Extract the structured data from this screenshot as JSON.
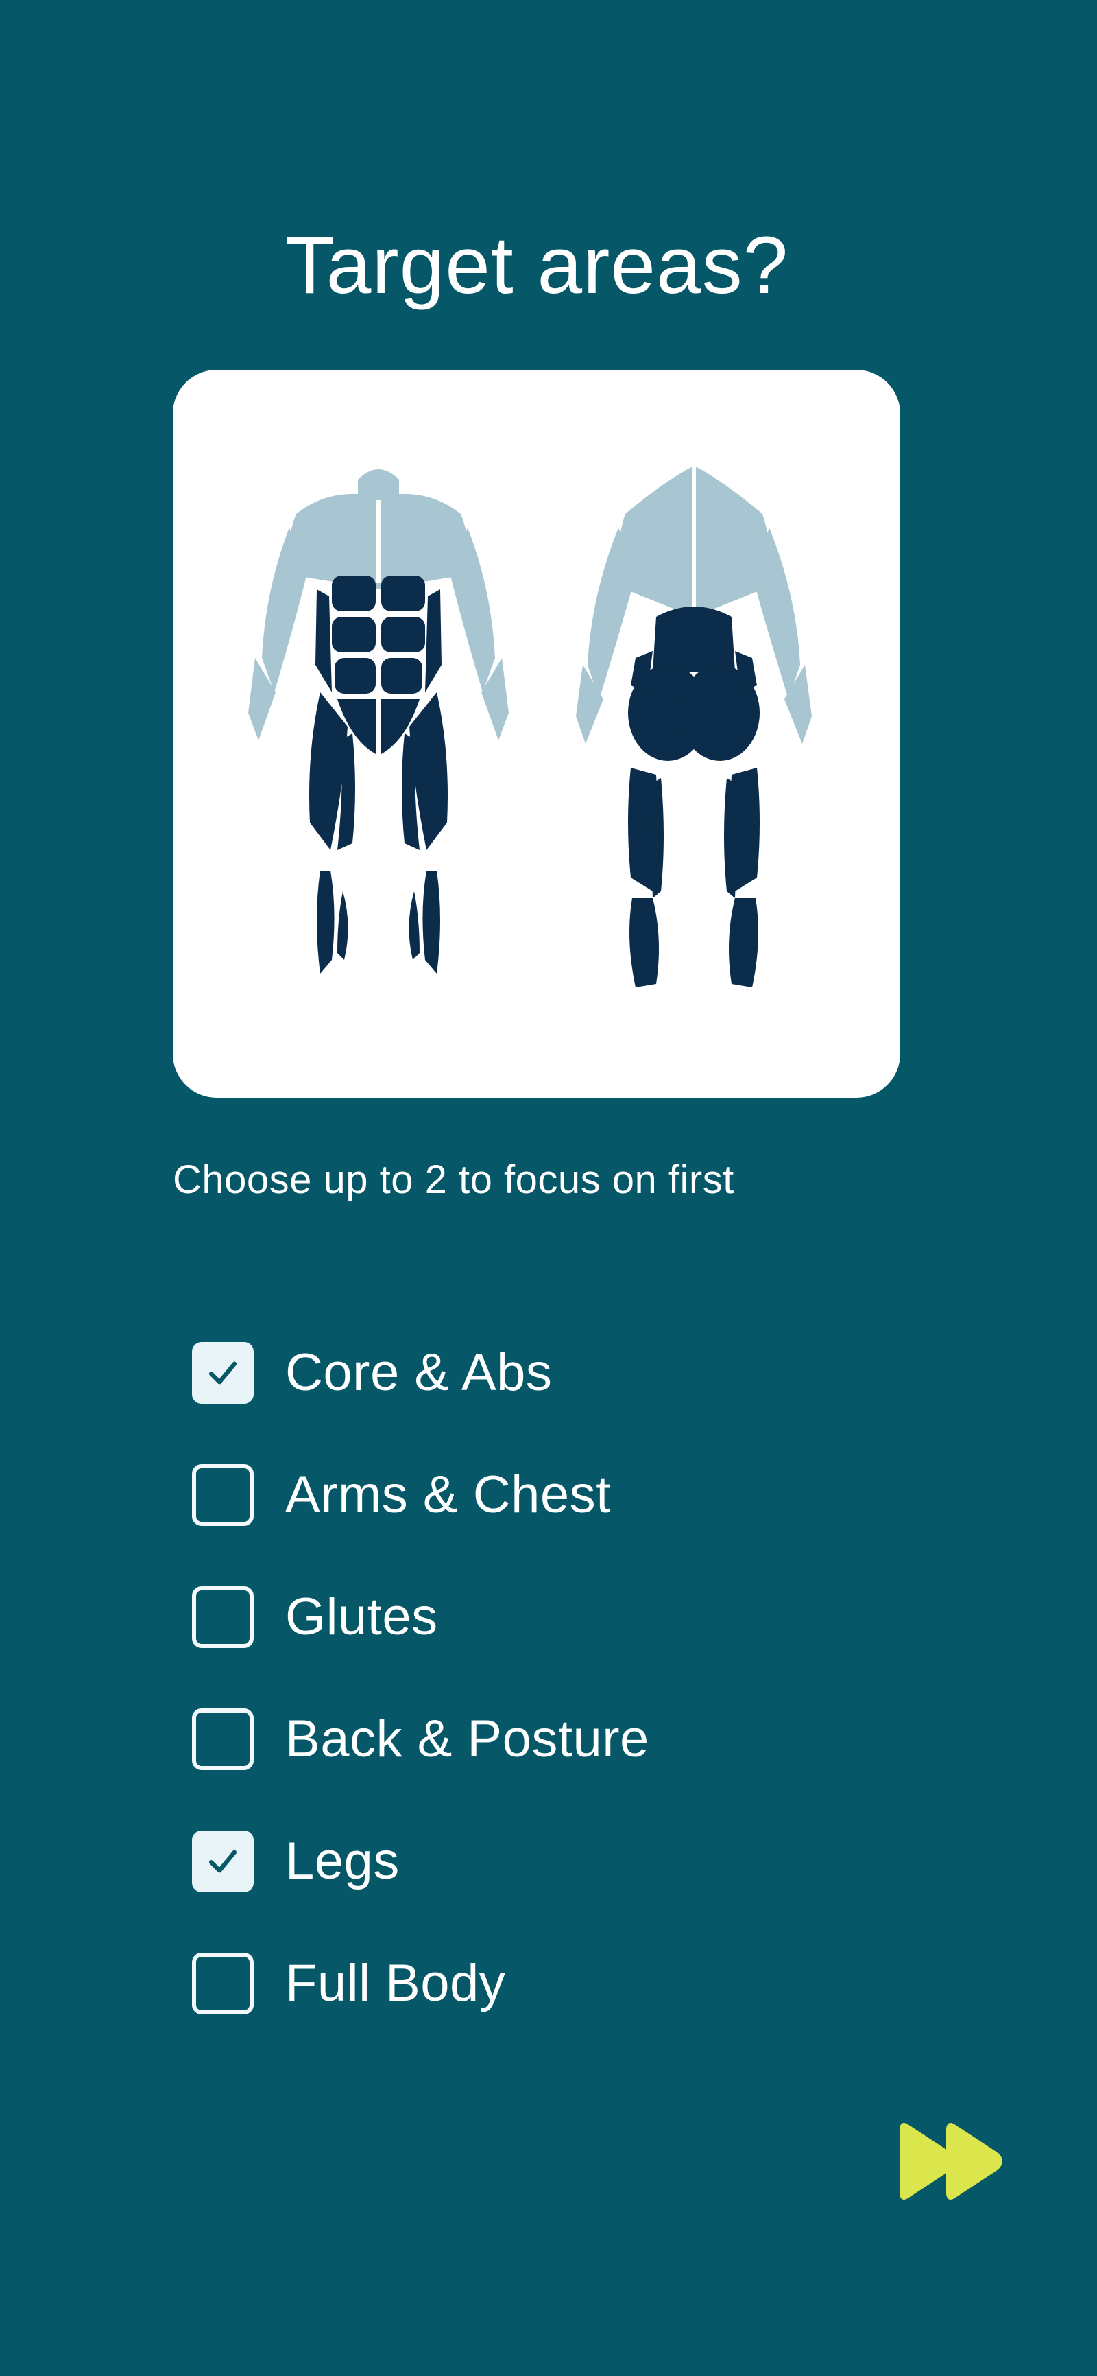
{
  "screen": {
    "title": "Target areas?",
    "subtitle": "Choose up to 2 to focus on first"
  },
  "hero_image": {
    "icon": "muscle-anatomy-illustration",
    "highlight_color": "#0b2d4b",
    "muscle_color": "#a8c6d2"
  },
  "options": [
    {
      "label": "Core & Abs",
      "checked": true
    },
    {
      "label": "Arms & Chest",
      "checked": false
    },
    {
      "label": "Glutes",
      "checked": false
    },
    {
      "label": "Back & Posture",
      "checked": false
    },
    {
      "label": "Legs",
      "checked": true
    },
    {
      "label": "Full Body",
      "checked": false
    }
  ],
  "next_button": {
    "icon": "double-chevron-right-icon",
    "color": "#dbe54c"
  },
  "colors": {
    "background": "#065868",
    "card": "#ffffff",
    "text": "#ffffff",
    "checkbox_fill": "#e9f4f9",
    "check_mark": "#065868"
  }
}
